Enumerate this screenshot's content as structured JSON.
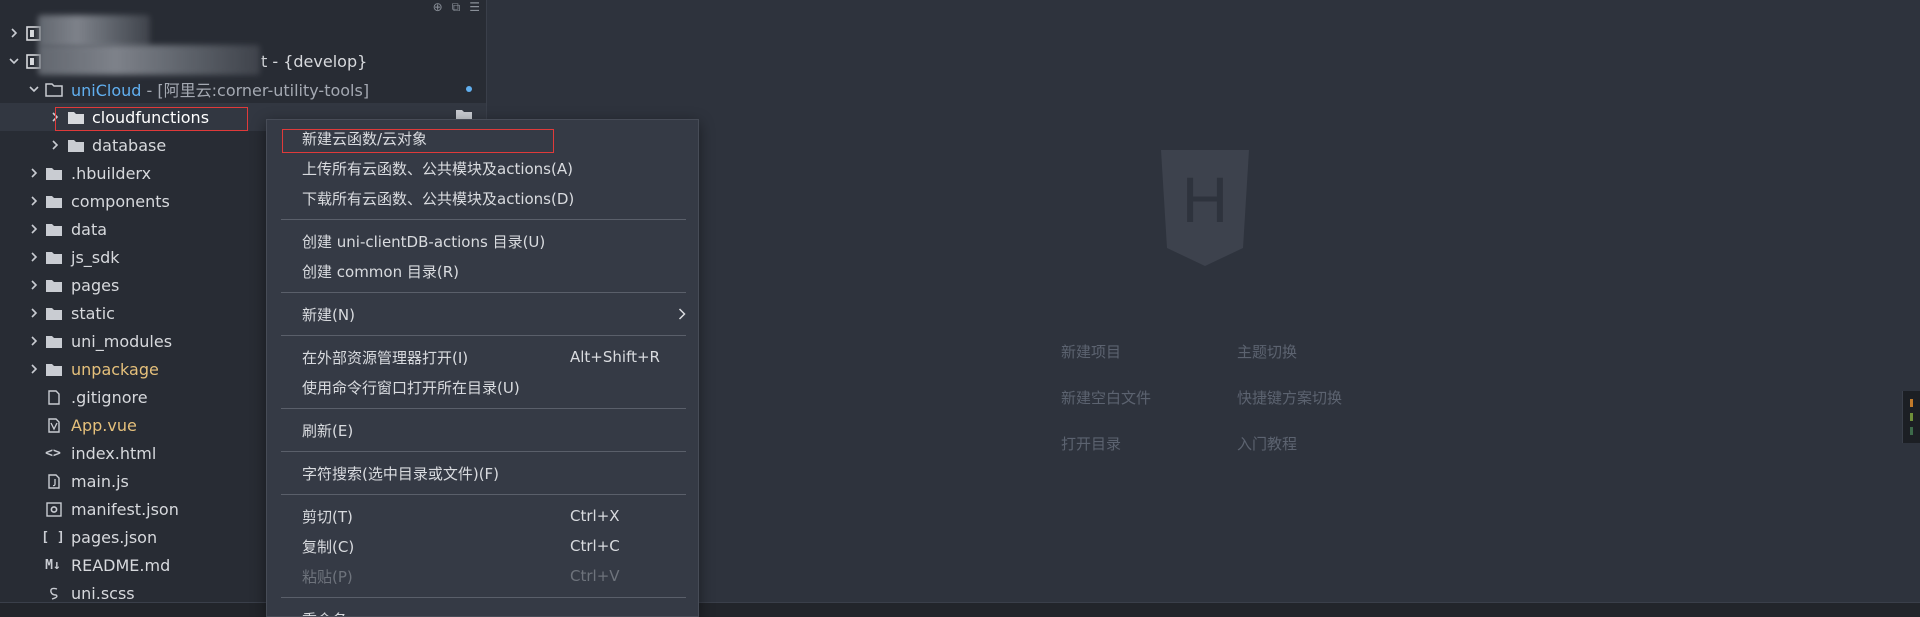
{
  "sidebar": {
    "tools": [
      "⊕",
      "⧉",
      "☰"
    ],
    "tree": [
      {
        "name": "",
        "type": "project",
        "expanded": false
      },
      {
        "name": "t - {develop}",
        "type": "project",
        "expanded": true
      },
      {
        "name": "uniCloud",
        "suffix": " - [阿里云:corner-utility-tools]",
        "type": "folder",
        "color": "#61afef"
      },
      {
        "name": "cloudfunctions",
        "type": "folder"
      },
      {
        "name": "database",
        "type": "folder"
      },
      {
        "name": ".hbuilderx",
        "type": "folder"
      },
      {
        "name": "components",
        "type": "folder"
      },
      {
        "name": "data",
        "type": "folder"
      },
      {
        "name": "js_sdk",
        "type": "folder"
      },
      {
        "name": "pages",
        "type": "folder"
      },
      {
        "name": "static",
        "type": "folder"
      },
      {
        "name": "uni_modules",
        "type": "folder"
      },
      {
        "name": "unpackage",
        "type": "folder",
        "color": "#e5c07b"
      },
      {
        "name": ".gitignore",
        "type": "file"
      },
      {
        "name": "App.vue",
        "type": "vue",
        "color": "#e5c07b"
      },
      {
        "name": "index.html",
        "type": "html"
      },
      {
        "name": "main.js",
        "type": "js"
      },
      {
        "name": "manifest.json",
        "type": "manifest"
      },
      {
        "name": "pages.json",
        "type": "json"
      },
      {
        "name": "README.md",
        "type": "md"
      },
      {
        "name": "uni.scss",
        "type": "scss"
      }
    ]
  },
  "context_menu": {
    "items": [
      {
        "label": "新建云函数/云对象",
        "shortcut": ""
      },
      {
        "label": "上传所有云函数、公共模块及actions(A)",
        "shortcut": ""
      },
      {
        "label": "下载所有云函数、公共模块及actions(D)",
        "shortcut": ""
      },
      {
        "label": "创建 uni-clientDB-actions 目录(U)",
        "shortcut": ""
      },
      {
        "label": "创建 common 目录(R)",
        "shortcut": ""
      },
      {
        "label": "新建(N)",
        "shortcut": "",
        "submenu": true
      },
      {
        "label": "在外部资源管理器打开(I)",
        "shortcut": "Alt+Shift+R"
      },
      {
        "label": "使用命令行窗口打开所在目录(U)",
        "shortcut": ""
      },
      {
        "label": "刷新(E)",
        "shortcut": ""
      },
      {
        "label": "字符搜索(选中目录或文件)(F)",
        "shortcut": ""
      },
      {
        "label": "剪切(T)",
        "shortcut": "Ctrl+X"
      },
      {
        "label": "复制(C)",
        "shortcut": "Ctrl+C"
      },
      {
        "label": "粘贴(P)",
        "shortcut": "Ctrl+V",
        "disabled": true
      },
      {
        "label": "重命名",
        "shortcut": ""
      }
    ]
  },
  "welcome": {
    "logo_letter": "H",
    "links": [
      "新建项目",
      "主题切换",
      "新建空白文件",
      "快捷键方案切换",
      "打开目录",
      "入门教程"
    ]
  },
  "colors": {
    "accent_blue": "#61afef",
    "accent_yellow": "#e5c07b",
    "highlight_red": "#e03a3a"
  }
}
